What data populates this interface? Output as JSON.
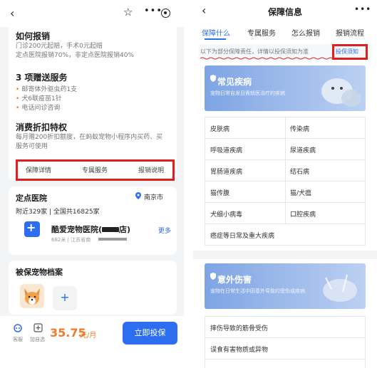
{
  "left": {
    "claim": {
      "title": "如何报销",
      "lines": [
        "门诊200元起赔，手术0元起赔",
        "定点医院报销70%，非定点医院报销40%"
      ]
    },
    "gifts": {
      "title": "3 项赠送服务",
      "items": [
        "邮寄体外驱虫药1支",
        "犬6联疫苗1针",
        "电话问诊咨询"
      ]
    },
    "consume": {
      "title": "消费折扣特权",
      "lines": [
        "每月赠200折扣额度，在蚂蚁宠物小程序内买药、买",
        "服务可使用"
      ]
    },
    "tabs": [
      "保障详情",
      "专属服务",
      "报销说明"
    ],
    "hospital": {
      "title": "定点医院",
      "city": "南京市",
      "count": "附近329家 | 全国共16825家",
      "name": "酷爱宠物医院(",
      "name_suffix": "店)",
      "meta": "682米 | 江苏省南",
      "more": "更多"
    },
    "pets": {
      "title": "被保宠物档案",
      "add": "+"
    },
    "bottom": {
      "icon1_label": "客服",
      "icon2_label": "加自选",
      "price": "35.75",
      "unit": "元/月",
      "buy": "立即投保"
    }
  },
  "right": {
    "title": "保障信息",
    "tabs": [
      "保障什么",
      "专属服务",
      "怎么报销",
      "报销流程"
    ],
    "notice": "以下为部分保障责任，详情以投保须知为准",
    "notice_link": "投保须知",
    "disease": {
      "title": "常见疾病",
      "sub": "宠物日常自发且需就医治疗的疾病",
      "rows": [
        [
          "皮肤病",
          "传染病"
        ],
        [
          "呼吸道疾病",
          "尿道疾病"
        ],
        [
          "胃肠道疾病",
          "结石病"
        ],
        [
          "猫传腹",
          "猫/犬瘟"
        ],
        [
          "犬细小病毒",
          "口腔疾病"
        ]
      ],
      "full_row": "癌症等日常及重大疾病"
    },
    "accident": {
      "title": "意外伤害",
      "sub": "宠物在日常生活中因意外导致的受伤或疾病",
      "rows": [
        "摔伤导致的筋骨受伤",
        "误食有害物质或异物"
      ]
    }
  },
  "colors": {
    "accent": "#2d6ef0",
    "orange": "#f07a2a",
    "highlight_box": "#e02020"
  }
}
